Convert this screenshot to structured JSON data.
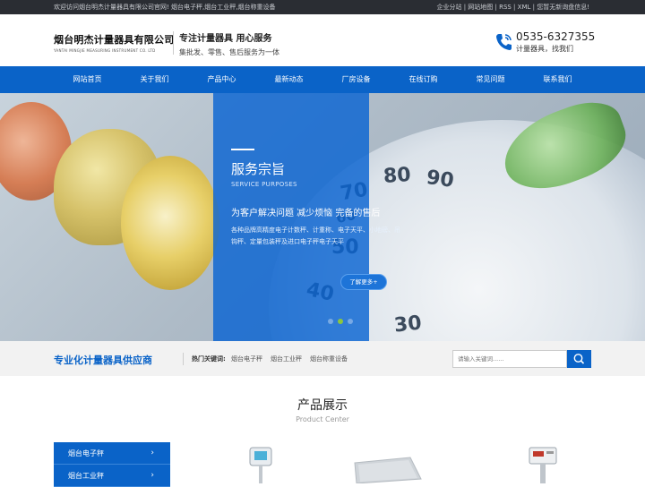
{
  "topbar": {
    "welcome": "欢迎访问烟台明杰计量器具有限公司官网!  烟台电子秤,烟台工业秤,烟台称重设备",
    "links": "企业分站 | 网站地图 | RSS | XML | 您暂无新询盘信息!"
  },
  "header": {
    "logo_cn": "烟台明杰计量器具有限公司",
    "logo_en": "YANTAI MINGJIE MEASURING INSTRUMENT CO. LTD",
    "slogan_main": "专注计量器具  用心服务",
    "slogan_sub": "集批发、零售、售后服务为一体",
    "phone": "0535-6327355",
    "phone_sub": "计量器具，找我们"
  },
  "nav": [
    "网站首页",
    "关于我们",
    "产品中心",
    "最新动态",
    "厂房设备",
    "在线订购",
    "常见问题",
    "联系我们"
  ],
  "banner": {
    "title": "服务宗旨",
    "subtitle": "SERVICE PURPOSES",
    "headline": "为客户解决问题 减少烦恼 完备的售后",
    "desc": "各种品牌高精度电子计数秤、计重称、电子天平、小地磅、吊钩秤、定量包装秤及进口电子秤电子天平",
    "more": "了解更多+",
    "scale_numbers": [
      "70",
      "80",
      "90",
      "50",
      "40",
      "30",
      "60"
    ]
  },
  "search": {
    "heading": "专业化计量器具供应商",
    "hot_label": "热门关键词:",
    "keywords": [
      "烟台电子秤",
      "烟台工业秤",
      "烟台称重设备"
    ],
    "placeholder": "请输入关键词......"
  },
  "products": {
    "title": "产品展示",
    "subtitle": "Product Center",
    "categories": [
      "烟台电子秤",
      "烟台工业秤"
    ]
  },
  "colors": {
    "primary": "#0a63c8",
    "topbar": "#2a2d33",
    "active_dot": "#8cc63f"
  }
}
